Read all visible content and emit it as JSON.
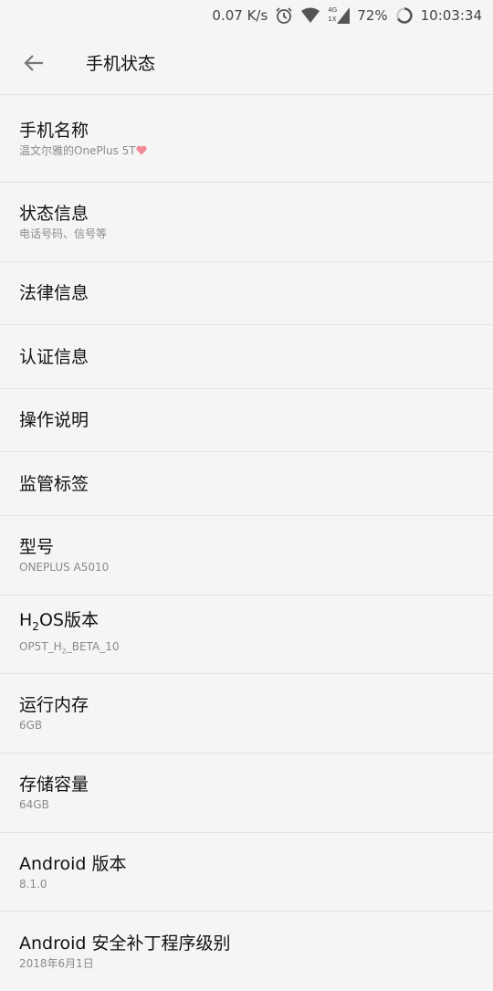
{
  "status_bar": {
    "speed": "0.07 K/s",
    "network_4g": "4G",
    "network_1x": "1X",
    "battery": "72%",
    "time": "10:03:34"
  },
  "header": {
    "title": "手机状态"
  },
  "items": [
    {
      "label": "手机名称",
      "sub": "温文尔雅的OnePlus 5T",
      "sub_icon": "heart-icon"
    },
    {
      "label": "状态信息",
      "sub": "电话号码、信号等"
    },
    {
      "label": "法律信息"
    },
    {
      "label": "认证信息"
    },
    {
      "label": "操作说明"
    },
    {
      "label": "监管标签"
    },
    {
      "label": "型号",
      "sub": "ONEPLUS A5010"
    },
    {
      "label_h": "H",
      "label_sub": "2",
      "label_rest": "OS版本",
      "sub_pre": "OP5T_H",
      "sub_sub": "2",
      "sub_post": "_BETA_10"
    },
    {
      "label": "运行内存",
      "sub": "6GB"
    },
    {
      "label": "存储容量",
      "sub": "64GB"
    },
    {
      "label": "Android 版本",
      "sub": "8.1.0"
    },
    {
      "label": "Android 安全补丁程序级别",
      "sub": "2018年6月1日"
    }
  ],
  "colors": {
    "heart": "#f08a95"
  }
}
